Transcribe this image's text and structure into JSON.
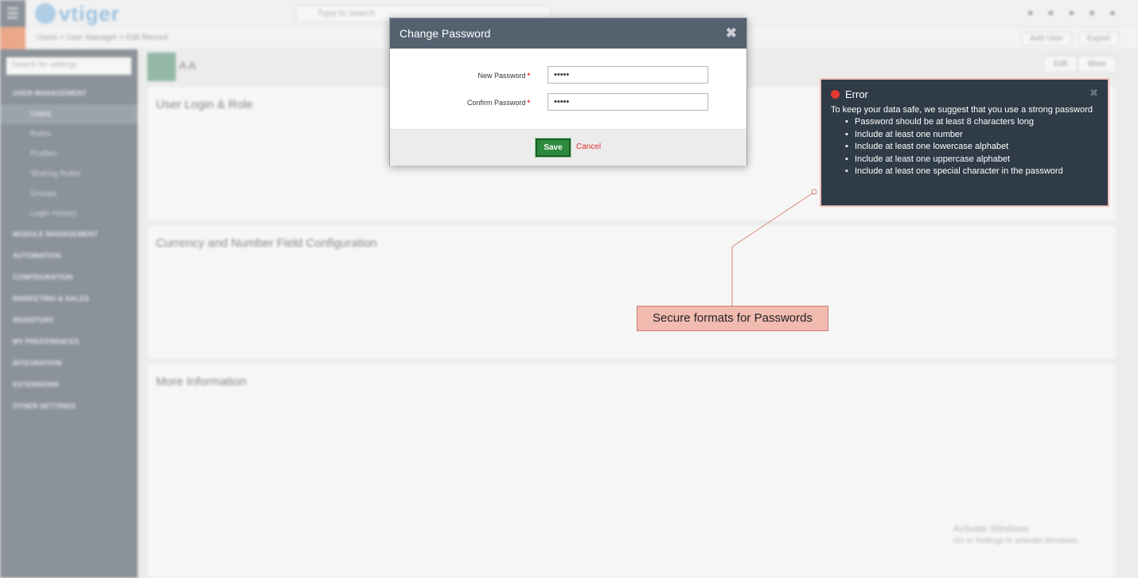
{
  "modal": {
    "title": "Change Password",
    "close_glyph": "✖",
    "new_password_label": "New Password",
    "confirm_password_label": "Confirm Password",
    "required_marker": "*",
    "new_password_value": "•••••",
    "confirm_password_value": "•••••",
    "save_label": "Save",
    "cancel_label": "Cancel"
  },
  "error": {
    "title": "Error",
    "close_glyph": "✖",
    "message": "To keep your data safe, we suggest that you use a strong password",
    "rules": [
      "Password should be at least 8 characters long",
      "Include at least one number",
      "Include at least one lowercase alphabet",
      "Include at least one uppercase alphabet",
      "Include at least one special character in the password"
    ]
  },
  "annotation": {
    "label": "Secure formats for Passwords"
  },
  "background": {
    "logo": "vtiger",
    "search_placeholder": "Type to search",
    "breadcrumb": "Users > User Manager > Edit Record",
    "sub_actions": [
      "Add User",
      "Export"
    ],
    "sidebar_search": "Search for settings",
    "sidebar_sections": [
      "USER MANAGEMENT",
      "MODULE MANAGEMENT",
      "AUTOMATION",
      "CONFIGURATION",
      "MARKETING & SALES",
      "INVENTORY",
      "MY PREFERENCES",
      "INTEGRATION",
      "EXTENSIONS",
      "OTHER SETTINGS"
    ],
    "sidebar_subitems": [
      "Users",
      "Roles",
      "Profiles",
      "Sharing Rules",
      "Groups",
      "Login History"
    ],
    "user_name": "A A",
    "edit_buttons": [
      "Edit",
      "More"
    ],
    "panels": [
      "User Login & Role",
      "Currency and Number Field Configuration",
      "More Information"
    ],
    "watermark_title": "Activate Windows",
    "watermark_sub": "Go to Settings to activate Windows."
  },
  "colors": {
    "header_bg": "#546270",
    "save_green": "#2d8a3d",
    "cancel_red": "#e0312f",
    "error_bg": "#2f3b47",
    "annotation_bg": "#f2bbb0"
  }
}
